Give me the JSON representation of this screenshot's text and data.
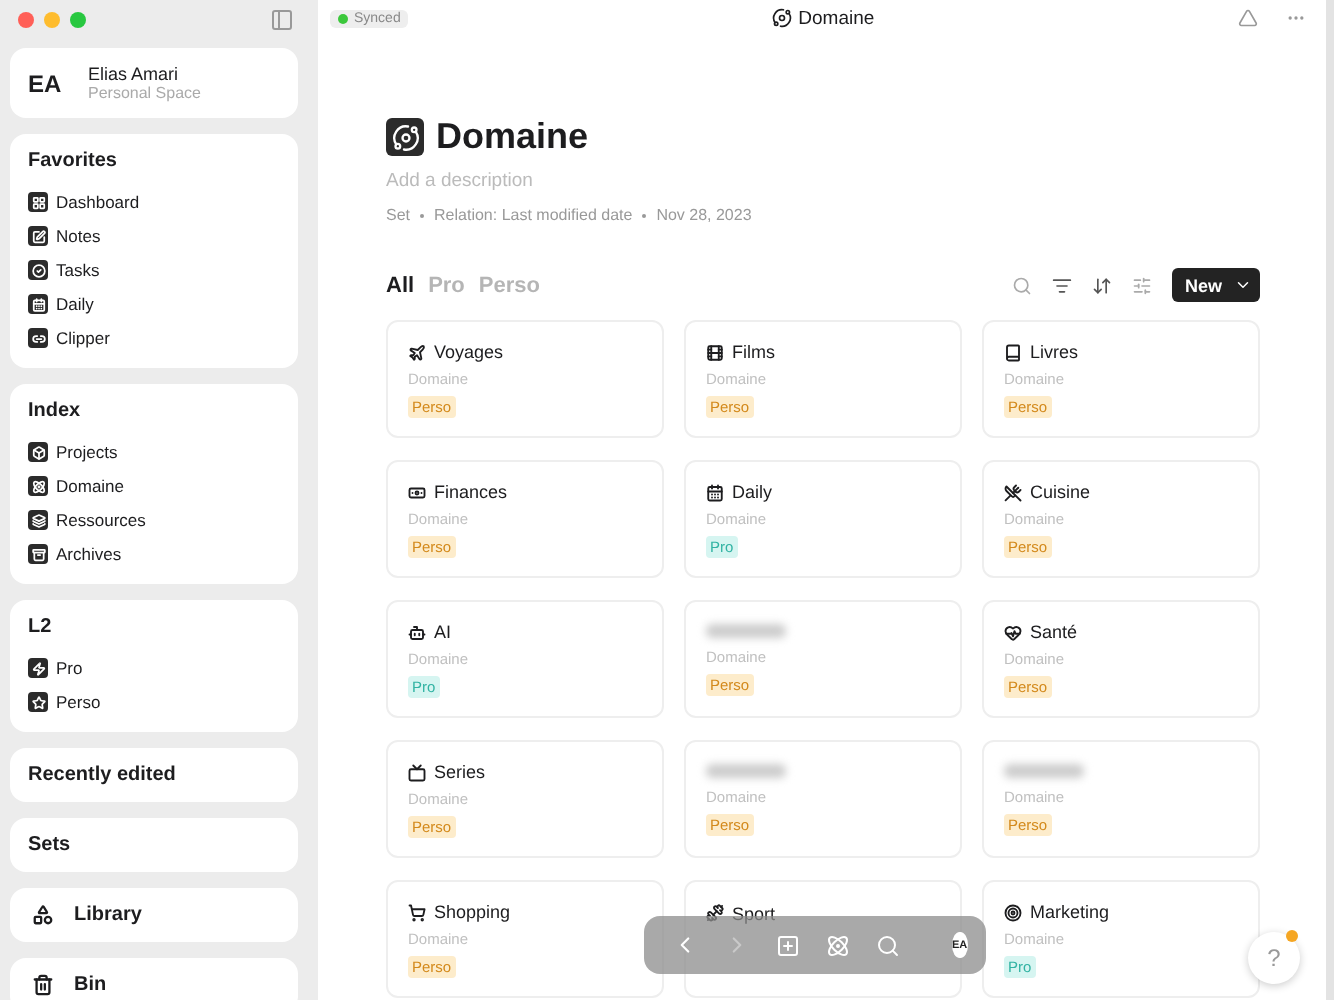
{
  "window": {
    "title": "Domaine",
    "sync_status": "Synced"
  },
  "profile": {
    "initials": "EA",
    "name": "Elias Amari",
    "space": "Personal Space"
  },
  "sidebar_groups": [
    {
      "title": "Favorites",
      "items": [
        {
          "label": "Dashboard"
        },
        {
          "label": "Notes"
        },
        {
          "label": "Tasks"
        },
        {
          "label": "Daily"
        },
        {
          "label": "Clipper"
        }
      ]
    },
    {
      "title": "Index",
      "items": [
        {
          "label": "Projects"
        },
        {
          "label": "Domaine"
        },
        {
          "label": "Ressources"
        },
        {
          "label": "Archives"
        }
      ]
    },
    {
      "title": "L2",
      "items": [
        {
          "label": "Pro"
        },
        {
          "label": "Perso"
        }
      ]
    },
    {
      "title": "Recently edited"
    },
    {
      "title": "Sets"
    }
  ],
  "sidebar_links": [
    {
      "label": "Library"
    },
    {
      "label": "Bin"
    }
  ],
  "page": {
    "title": "Domaine",
    "description_placeholder": "Add a description",
    "meta": [
      "Set",
      "Relation: Last modified date",
      "Nov 28, 2023"
    ]
  },
  "views": [
    {
      "label": "All",
      "selected": true
    },
    {
      "label": "Pro",
      "selected": false
    },
    {
      "label": "Perso",
      "selected": false
    }
  ],
  "new_button": "New",
  "cards": [
    {
      "title": "Voyages",
      "subtitle": "Domaine",
      "tag": {
        "label": "Perso",
        "kind": "perso"
      }
    },
    {
      "title": "Films",
      "subtitle": "Domaine",
      "tag": {
        "label": "Perso",
        "kind": "perso"
      }
    },
    {
      "title": "Livres",
      "subtitle": "Domaine",
      "tag": {
        "label": "Perso",
        "kind": "perso"
      }
    },
    {
      "title": "Finances",
      "subtitle": "Domaine",
      "tag": {
        "label": "Perso",
        "kind": "perso"
      }
    },
    {
      "title": "Daily",
      "subtitle": "Domaine",
      "tag": {
        "label": "Pro",
        "kind": "pro"
      }
    },
    {
      "title": "Cuisine",
      "subtitle": "Domaine",
      "tag": {
        "label": "Perso",
        "kind": "perso"
      }
    },
    {
      "title": "AI",
      "subtitle": "Domaine",
      "tag": {
        "label": "Pro",
        "kind": "pro"
      }
    },
    {
      "blurred": true,
      "subtitle": "Domaine",
      "tag": {
        "label": "Perso",
        "kind": "perso"
      }
    },
    {
      "title": "Santé",
      "subtitle": "Domaine",
      "tag": {
        "label": "Perso",
        "kind": "perso"
      }
    },
    {
      "title": "Series",
      "subtitle": "Domaine",
      "tag": {
        "label": "Perso",
        "kind": "perso"
      }
    },
    {
      "blurred": true,
      "subtitle": "Domaine",
      "tag": {
        "label": "Perso",
        "kind": "perso"
      }
    },
    {
      "blurred": true,
      "subtitle": "Domaine",
      "tag": {
        "label": "Perso",
        "kind": "perso"
      }
    },
    {
      "title": "Shopping",
      "subtitle": "Domaine",
      "tag": {
        "label": "Perso",
        "kind": "perso"
      }
    },
    {
      "title": "Sport"
    },
    {
      "title": "Marketing",
      "subtitle": "Domaine",
      "tag": {
        "label": "Pro",
        "kind": "pro"
      }
    }
  ],
  "dock": {
    "avatar": "EA",
    "forward_disabled": true
  },
  "help": {
    "label": "?",
    "notification": true
  }
}
